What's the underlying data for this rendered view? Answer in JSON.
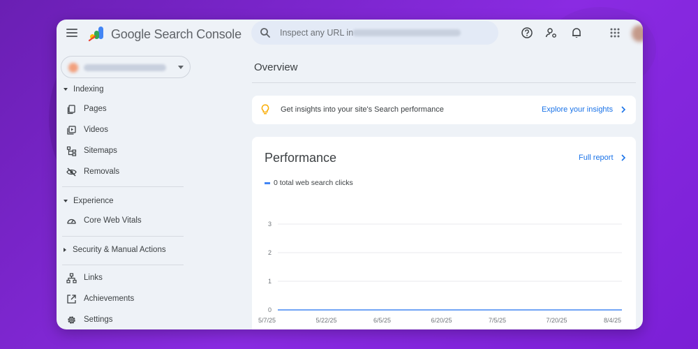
{
  "header": {
    "app_name": "Google Search Console",
    "search_placeholder": "Inspect any URL in"
  },
  "sidebar": {
    "sections": [
      {
        "label": "Indexing",
        "items": [
          "Pages",
          "Videos",
          "Sitemaps",
          "Removals"
        ]
      },
      {
        "label": "Experience",
        "items": [
          "Core Web Vitals"
        ]
      },
      {
        "label": "Security & Manual Actions",
        "items": []
      }
    ],
    "bottom_items": [
      "Links",
      "Achievements",
      "Settings"
    ]
  },
  "main": {
    "title": "Overview",
    "insights": {
      "text": "Get insights into your site's Search performance",
      "link": "Explore your insights"
    },
    "performance": {
      "title": "Performance",
      "link": "Full report",
      "legend": "0 total web search clicks"
    }
  },
  "colors": {
    "accent": "#1a73e8",
    "series": "#4285f4",
    "bulb": "#f9ab00"
  },
  "chart_data": {
    "type": "line",
    "x": [
      "5/7/25",
      "5/22/25",
      "6/5/25",
      "6/20/25",
      "7/5/25",
      "7/20/25",
      "8/4/25"
    ],
    "series": [
      {
        "name": "0 total web search clicks",
        "values": [
          0,
          0,
          0,
          0,
          0,
          0,
          0
        ]
      }
    ],
    "y_ticks": [
      0,
      1,
      2,
      3
    ],
    "ylim": [
      0,
      3
    ],
    "grid": true
  }
}
